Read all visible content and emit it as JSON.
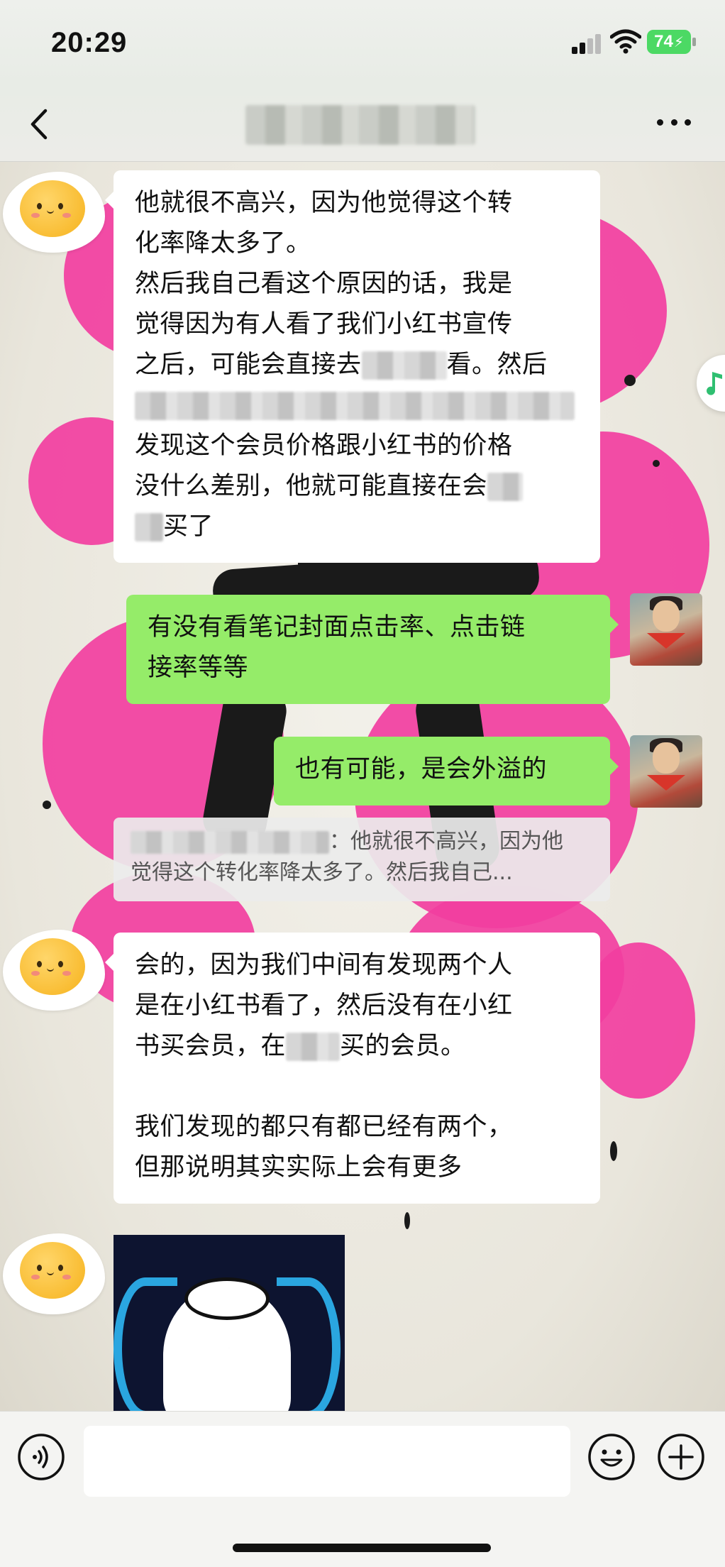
{
  "status_bar": {
    "time": "20:29",
    "battery": "74"
  },
  "nav": {
    "title": "▓▓▓ ▓▓▓▓"
  },
  "messages": {
    "m1": {
      "l1": "他就很不高兴，因为他觉得这个转",
      "l2": "化率降太多了。",
      "l3": "然后我自己看这个原因的话，我是",
      "l4": "觉得因为有人看了我们小红书宣传",
      "l5a": "之后，可能会直接去",
      "l5b": "看。然后",
      "l7": "发现这个会员价格跟小红书的价格",
      "l8": "没什么差别，他就可能直接在会",
      "l9": "买了"
    },
    "m2": {
      "l1": "有没有看笔记封面点击率、点击链",
      "l2": "接率等等"
    },
    "m3": {
      "text": "也有可能，是会外溢的"
    },
    "quote": {
      "suffix": "：他就很不高兴，因为他",
      "line2": "觉得这个转化率降太多了。然后我自己..."
    },
    "m4": {
      "l1": "会的，因为我们中间有发现两个人",
      "l2": "是在小红书看了，然后没有在小红",
      "l3a": "书买会员，在",
      "l3b": "买的会员。",
      "l4": "我们发现的都只有都已经有两个，",
      "l5": "但那说明其实实际上会有更多"
    }
  },
  "colors": {
    "out_bubble": "#95ec69",
    "in_bubble": "#ffffff",
    "battery": "#4cd964",
    "splash": "#f23ea0"
  },
  "icons": [
    "back-icon",
    "more-icon",
    "signal-icon",
    "wifi-icon",
    "music-note-icon",
    "voice-icon",
    "emoji-icon",
    "plus-icon"
  ]
}
